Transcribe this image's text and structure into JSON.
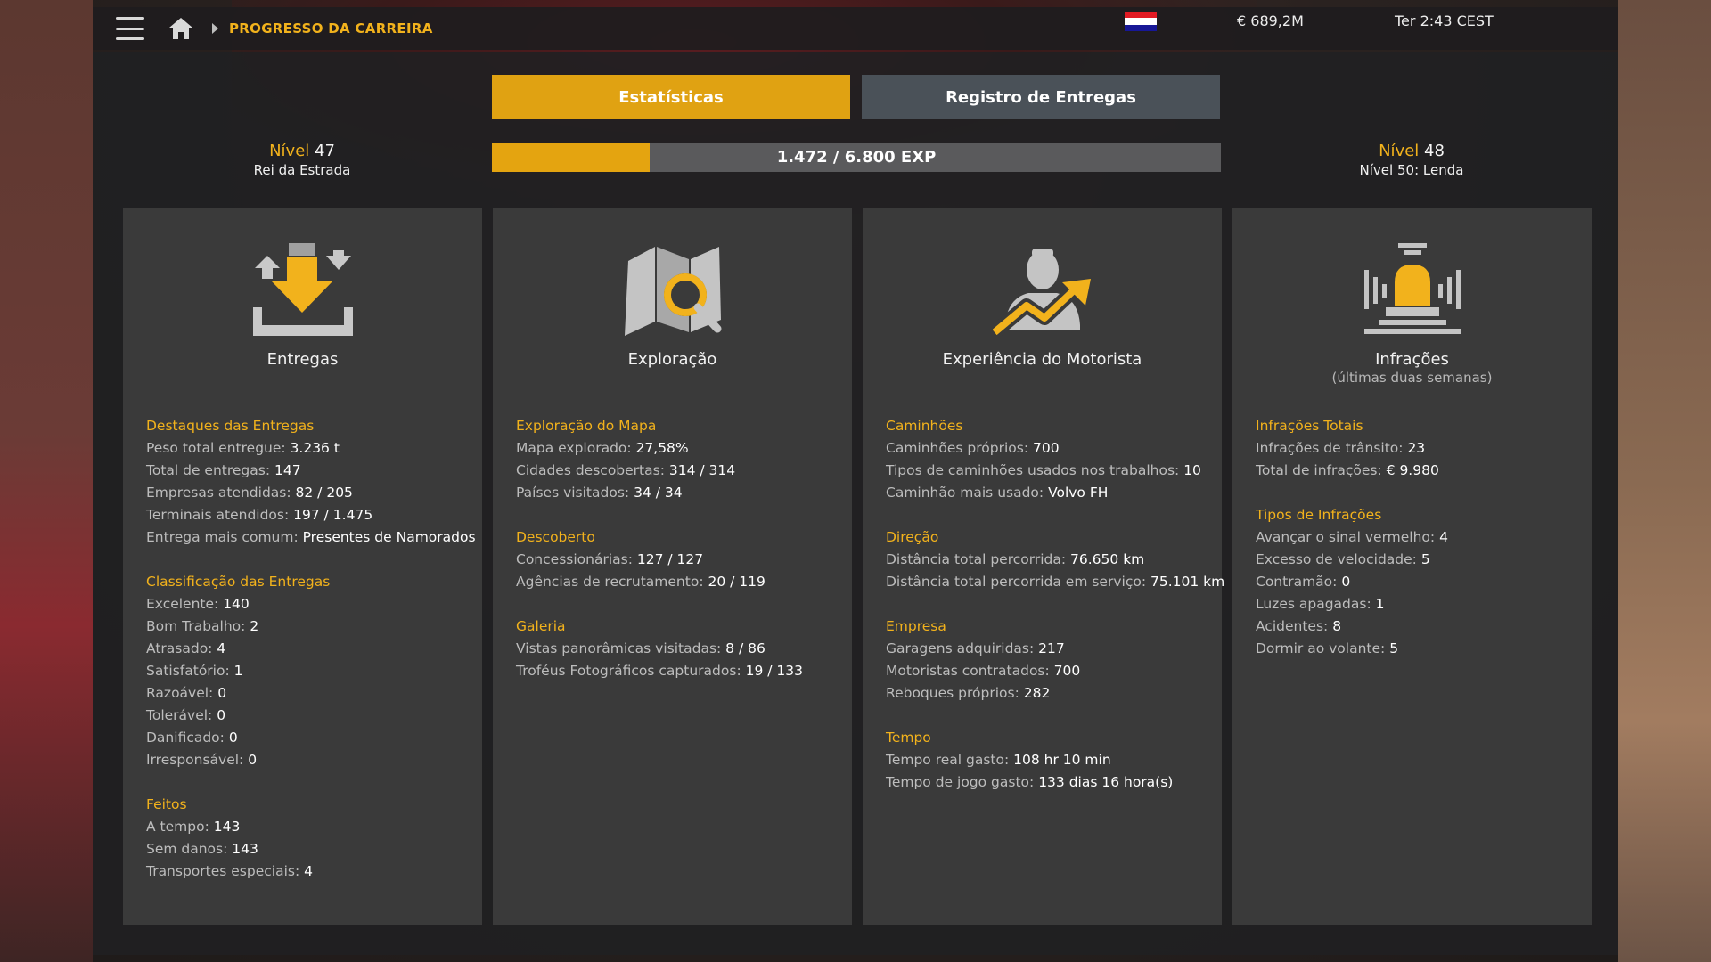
{
  "topbar": {
    "breadcrumb": "PROGRESSO DA CARREIRA",
    "money": "€ 689,2M",
    "time": "Ter 2:43 CEST",
    "flag_colors": [
      "#e21a23",
      "#ffffff",
      "#171796"
    ]
  },
  "tabs": [
    {
      "label": "Estatísticas",
      "active": true
    },
    {
      "label": "Registro de Entregas",
      "active": false
    }
  ],
  "level": {
    "current_label": "Nível",
    "current": "47",
    "current_title": "Rei da Estrada",
    "next_label": "Nível",
    "next": "48",
    "next_title": "Nível 50: Lenda",
    "xp_text": "1.472 / 6.800 EXP",
    "xp_fraction": 0.2165
  },
  "colors": {
    "accent": "#f2b21c",
    "bar_fill": "#e4a410",
    "panel_bg": "#3a3a3a"
  },
  "panels": [
    {
      "title": "Entregas",
      "subtitle": "",
      "icon": "delivery-icon",
      "sections": [
        {
          "title": "Destaques das Entregas",
          "rows": [
            {
              "label": "Peso total entregue: ",
              "value": "3.236 t"
            },
            {
              "label": "Total de entregas: ",
              "value": "147"
            },
            {
              "label": "Empresas atendidas: ",
              "value": "82 / 205"
            },
            {
              "label": "Terminais atendidos: ",
              "value": "197 / 1.475"
            },
            {
              "label": "Entrega mais comum: ",
              "value": "Presentes de Namorados"
            }
          ]
        },
        {
          "title": "Classificação das Entregas",
          "rows": [
            {
              "label": "Excelente: ",
              "value": "140"
            },
            {
              "label": "Bom Trabalho: ",
              "value": "2"
            },
            {
              "label": "Atrasado: ",
              "value": "4"
            },
            {
              "label": "Satisfatório: ",
              "value": "1"
            },
            {
              "label": "Razoável: ",
              "value": "0"
            },
            {
              "label": "Tolerável: ",
              "value": "0"
            },
            {
              "label": "Danificado: ",
              "value": "0"
            },
            {
              "label": "Irresponsável: ",
              "value": "0"
            }
          ]
        },
        {
          "title": "Feitos",
          "rows": [
            {
              "label": "A tempo: ",
              "value": "143"
            },
            {
              "label": "Sem danos: ",
              "value": "143"
            },
            {
              "label": "Transportes especiais: ",
              "value": "4"
            }
          ]
        }
      ]
    },
    {
      "title": "Exploração",
      "subtitle": "",
      "icon": "map-search-icon",
      "sections": [
        {
          "title": "Exploração do Mapa",
          "rows": [
            {
              "label": "Mapa explorado: ",
              "value": "27,58%"
            },
            {
              "label": "Cidades descobertas: ",
              "value": "314 / 314"
            },
            {
              "label": "Países visitados: ",
              "value": "34 / 34"
            }
          ]
        },
        {
          "title": "Descoberto",
          "rows": [
            {
              "label": "Concessionárias: ",
              "value": "127 / 127"
            },
            {
              "label": "Agências de recrutamento: ",
              "value": "20 / 119"
            }
          ]
        },
        {
          "title": "Galeria",
          "rows": [
            {
              "label": "Vistas panorâmicas visitadas: ",
              "value": "8 / 86"
            },
            {
              "label": "Troféus Fotográficos capturados: ",
              "value": "19 / 133"
            }
          ]
        }
      ]
    },
    {
      "title": "Experiência do Motorista",
      "subtitle": "",
      "icon": "driver-growth-icon",
      "sections": [
        {
          "title": "Caminhões",
          "rows": [
            {
              "label": "Caminhões próprios: ",
              "value": "700"
            },
            {
              "label": "Tipos de caminhões usados nos trabalhos: ",
              "value": "10"
            },
            {
              "label": "Caminhão mais usado: ",
              "value": "Volvo FH"
            }
          ]
        },
        {
          "title": "Direção",
          "rows": [
            {
              "label": "Distância total percorrida: ",
              "value": "76.650 km"
            },
            {
              "label": "Distância total percorrida em serviço: ",
              "value": "75.101 km"
            }
          ]
        },
        {
          "title": "Empresa",
          "rows": [
            {
              "label": "Garagens adquiridas: ",
              "value": "217"
            },
            {
              "label": "Motoristas contratados: ",
              "value": "700"
            },
            {
              "label": "Reboques próprios: ",
              "value": "282"
            }
          ]
        },
        {
          "title": "Tempo",
          "rows": [
            {
              "label": "Tempo real gasto: ",
              "value": "108 hr 10 min"
            },
            {
              "label": "Tempo de jogo gasto: ",
              "value": "133 dias 16 hora(s)"
            }
          ]
        }
      ]
    },
    {
      "title": "Infrações",
      "subtitle": "(últimas duas semanas)",
      "icon": "siren-icon",
      "sections": [
        {
          "title": "Infrações Totais",
          "rows": [
            {
              "label": "Infrações de trânsito: ",
              "value": "23"
            },
            {
              "label": "Total de infrações: ",
              "value": "€ 9.980"
            }
          ]
        },
        {
          "title": "Tipos de Infrações",
          "rows": [
            {
              "label": "Avançar o sinal vermelho: ",
              "value": "4"
            },
            {
              "label": "Excesso de velocidade: ",
              "value": "5"
            },
            {
              "label": "Contramão: ",
              "value": "0"
            },
            {
              "label": "Luzes apagadas: ",
              "value": "1"
            },
            {
              "label": "Acidentes: ",
              "value": "8"
            },
            {
              "label": "Dormir ao volante: ",
              "value": "5"
            }
          ]
        }
      ]
    }
  ]
}
